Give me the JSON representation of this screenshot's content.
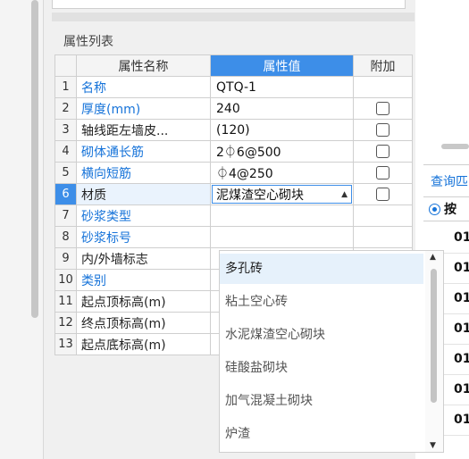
{
  "properties_panel": {
    "title": "属性列表",
    "headers": {
      "index": "",
      "name": "属性名称",
      "value": "属性值",
      "extra": "附加"
    },
    "rows": [
      {
        "num": "1",
        "name": "名称",
        "value": "QTQ-1",
        "blue": true,
        "checkbox": false
      },
      {
        "num": "2",
        "name": "厚度(mm)",
        "value": "240",
        "blue": true,
        "checkbox": true
      },
      {
        "num": "3",
        "name": "轴线距左墙皮...",
        "value": "(120)",
        "blue": false,
        "checkbox": true
      },
      {
        "num": "4",
        "name": "砌体通长筋",
        "value": "2⏀6@500",
        "blue": true,
        "checkbox": true
      },
      {
        "num": "5",
        "name": "横向短筋",
        "value": "⏀4@250",
        "blue": true,
        "checkbox": true
      },
      {
        "num": "6",
        "name": "材质",
        "value": "泥煤渣空心砌块",
        "blue": false,
        "checkbox": true,
        "selected": true
      },
      {
        "num": "7",
        "name": "砂浆类型",
        "value": "",
        "blue": true,
        "checkbox": false
      },
      {
        "num": "8",
        "name": "砂浆标号",
        "value": "",
        "blue": true,
        "checkbox": false
      },
      {
        "num": "9",
        "name": "内/外墙标志",
        "value": "",
        "blue": false,
        "checkbox": false
      },
      {
        "num": "10",
        "name": "类别",
        "value": "",
        "blue": true,
        "checkbox": false
      },
      {
        "num": "11",
        "name": "起点顶标高(m)",
        "value": "",
        "blue": false,
        "checkbox": false
      },
      {
        "num": "12",
        "name": "终点顶标高(m)",
        "value": "",
        "blue": false,
        "checkbox": false
      },
      {
        "num": "13",
        "name": "起点底标高(m)",
        "value": "",
        "blue": false,
        "checkbox": false
      }
    ]
  },
  "material_dropdown": {
    "options": [
      "多孔砖",
      "粘土空心砖",
      "水泥煤渣空心砌块",
      "硅酸盐砌块",
      "加气混凝土砌块",
      "炉渣"
    ],
    "highlighted_index": 0
  },
  "right_panel": {
    "query_tab": "查询匹",
    "radio_label": "按",
    "cells": [
      "01",
      "01",
      "01",
      "01",
      "01",
      "01",
      "01"
    ]
  }
}
